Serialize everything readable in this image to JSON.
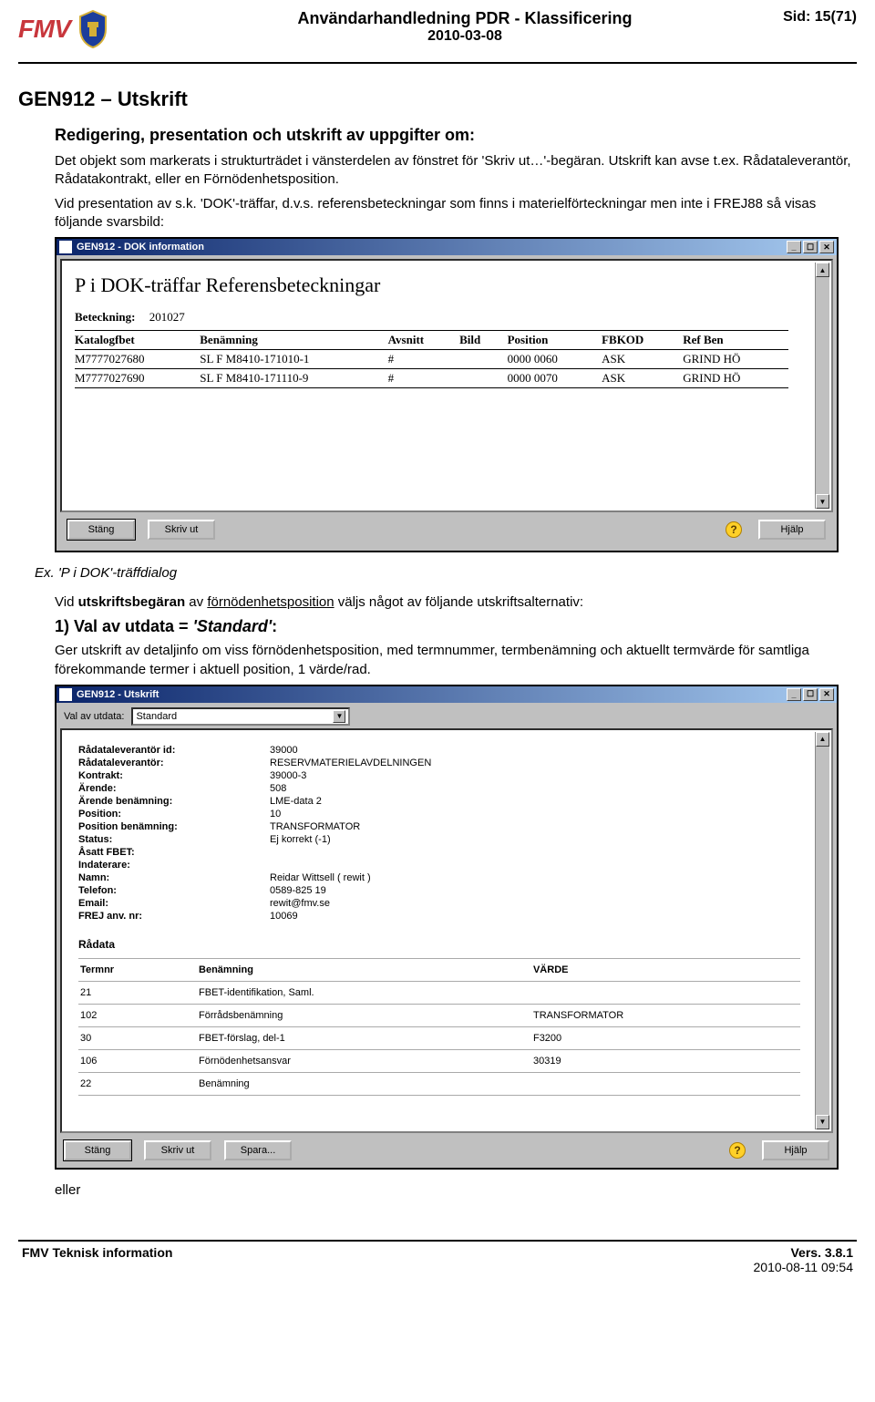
{
  "header": {
    "logo_text": "FMV",
    "title_line1": "Användarhandledning PDR - Klassificering",
    "title_line2": "2010-03-08",
    "page_num": "Sid: 15(71)"
  },
  "section": {
    "gen_title": "GEN912 – Utskrift",
    "red_title": "Redigering, presentation och utskrift av uppgifter om:",
    "para1": "Det objekt som markerats i strukturträdet i vänsterdelen av fönstret för 'Skriv ut…'-begäran. Utskrift kan avse t.ex. Rådataleverantör, Rådatakontrakt, eller en Förnödenhetsposition.",
    "para2": "Vid presentation av s.k. 'DOK'-träffar, d.v.s. referensbeteckningar som finns i materielförteckningar men inte i FREJ88 så visas följande svarsbild:"
  },
  "dialog1": {
    "title": "GEN912 - DOK information",
    "heading": "P i DOK-träffar Referensbeteckningar",
    "bet_label": "Beteckning:",
    "bet_value": "201027",
    "columns": [
      "Katalogfbet",
      "Benämning",
      "Avsnitt",
      "Bild",
      "Position",
      "FBKOD",
      "Ref Ben"
    ],
    "rows": [
      [
        "M7777027680",
        "SL F M8410-171010-1",
        "#",
        "",
        "0000 0060",
        "ASK",
        "GRIND HÖ"
      ],
      [
        "M7777027690",
        "SL F M8410-171110-9",
        "#",
        "",
        "0000 0070",
        "ASK",
        "GRIND HÖ"
      ]
    ],
    "btn_close": "Stäng",
    "btn_print": "Skriv ut",
    "btn_help": "Hjälp"
  },
  "caption1": "Ex. 'P i DOK'-träffdialog",
  "mid": {
    "para": "Vid utskriftsbegäran av förnödenhetsposition väljs något av följande utskriftsalternativ:",
    "h_before": "1) Val av utdata = ",
    "h_ital": "'Standard'",
    "h_after": ":",
    "para2": "Ger utskrift av detaljinfo om viss förnödenhetsposition, med termnummer, termbenämning och aktuellt termvärde för samtliga förekommande termer i aktuell position, 1 värde/rad."
  },
  "dialog2": {
    "title": "GEN912 - Utskrift",
    "select_label": "Val av utdata:",
    "select_value": "Standard",
    "info": [
      [
        "Rådataleverantör id:",
        "39000"
      ],
      [
        "Rådataleverantör:",
        "RESERVMATERIELAVDELNINGEN"
      ],
      [
        "Kontrakt:",
        "39000-3"
      ],
      [
        "Ärende:",
        "508"
      ],
      [
        "Ärende benämning:",
        "LME-data 2"
      ],
      [
        "Position:",
        "10"
      ],
      [
        "Position benämning:",
        "TRANSFORMATOR"
      ],
      [
        "Status:",
        "Ej korrekt (-1)"
      ],
      [
        "Åsatt FBET:",
        ""
      ],
      [
        "Indaterare:",
        ""
      ],
      [
        "Namn:",
        "Reidar Wittsell ( rewit )"
      ],
      [
        "Telefon:",
        "0589-825 19"
      ],
      [
        "Email:",
        "rewit@fmv.se"
      ],
      [
        "FREJ anv. nr:",
        "10069"
      ]
    ],
    "raw_heading": "Rådata",
    "raw_columns": [
      "Termnr",
      "Benämning",
      "VÄRDE"
    ],
    "raw_rows": [
      [
        "21",
        "FBET-identifikation, Saml.",
        ""
      ],
      [
        "102",
        "Förrådsbenämning",
        "TRANSFORMATOR"
      ],
      [
        "30",
        "FBET-förslag, del-1",
        "F3200"
      ],
      [
        "106",
        "Förnödenhetsansvar",
        "30319"
      ],
      [
        "22",
        "Benämning",
        ""
      ]
    ],
    "btn_close": "Stäng",
    "btn_print": "Skriv ut",
    "btn_save": "Spara...",
    "btn_help": "Hjälp"
  },
  "eller": "eller",
  "footer": {
    "left": "FMV Teknisk information",
    "right1": "Vers. 3.8.1",
    "right2": "2010-08-11 09:54"
  }
}
